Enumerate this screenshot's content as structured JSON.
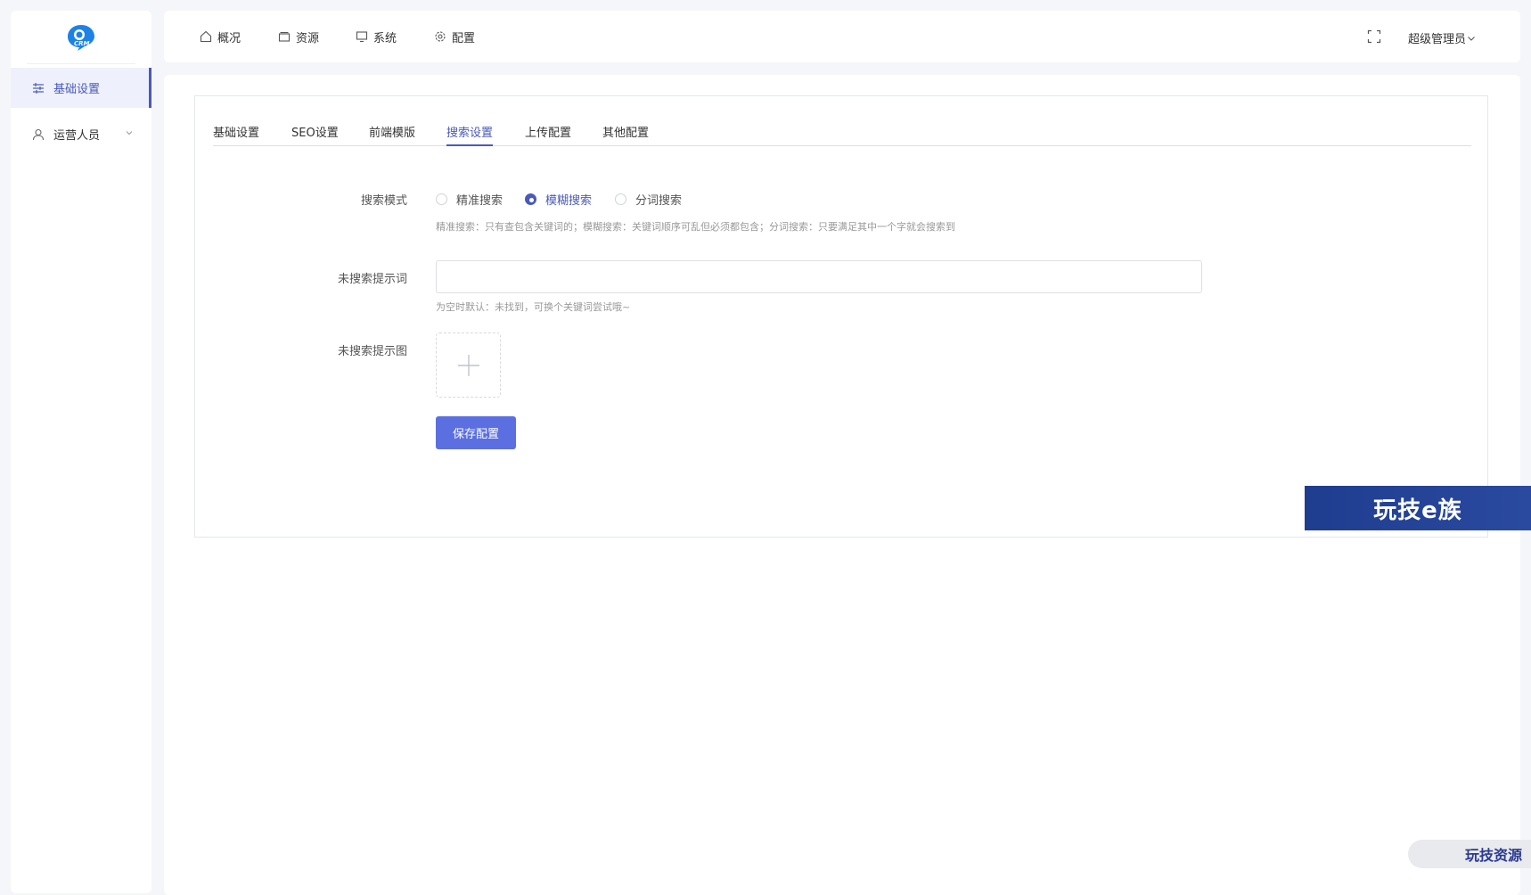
{
  "logo": {
    "text": "CRM"
  },
  "sidebar": {
    "items": [
      {
        "label": "基础设置"
      },
      {
        "label": "运营人员"
      }
    ]
  },
  "topnav": {
    "items": [
      {
        "label": "概况"
      },
      {
        "label": "资源"
      },
      {
        "label": "系统"
      },
      {
        "label": "配置"
      }
    ],
    "admin_label": "超级管理员"
  },
  "tabs": [
    {
      "label": "基础设置"
    },
    {
      "label": "SEO设置"
    },
    {
      "label": "前端模版"
    },
    {
      "label": "搜索设置"
    },
    {
      "label": "上传配置"
    },
    {
      "label": "其他配置"
    }
  ],
  "form": {
    "search_mode": {
      "label": "搜索模式",
      "options": [
        {
          "label": "精准搜索"
        },
        {
          "label": "模糊搜索"
        },
        {
          "label": "分词搜索"
        }
      ],
      "selected": "模糊搜索",
      "hint": "精准搜索：只有查包含关键词的；模糊搜索：关键词顺序可乱但必须都包含；分词搜索：只要满足其中一个字就会搜索到"
    },
    "no_result_word": {
      "label": "未搜索提示词",
      "value": "",
      "placeholder": "",
      "hint": "为空时默认：未找到，可换个关键词尝试哦~"
    },
    "no_result_image": {
      "label": "未搜索提示图"
    },
    "save_label": "保存配置"
  },
  "watermarks": {
    "banner": "玩技e族",
    "corner": "玩技资源"
  },
  "colors": {
    "accent": "#4a5ab8",
    "button": "#5b6fe0"
  }
}
